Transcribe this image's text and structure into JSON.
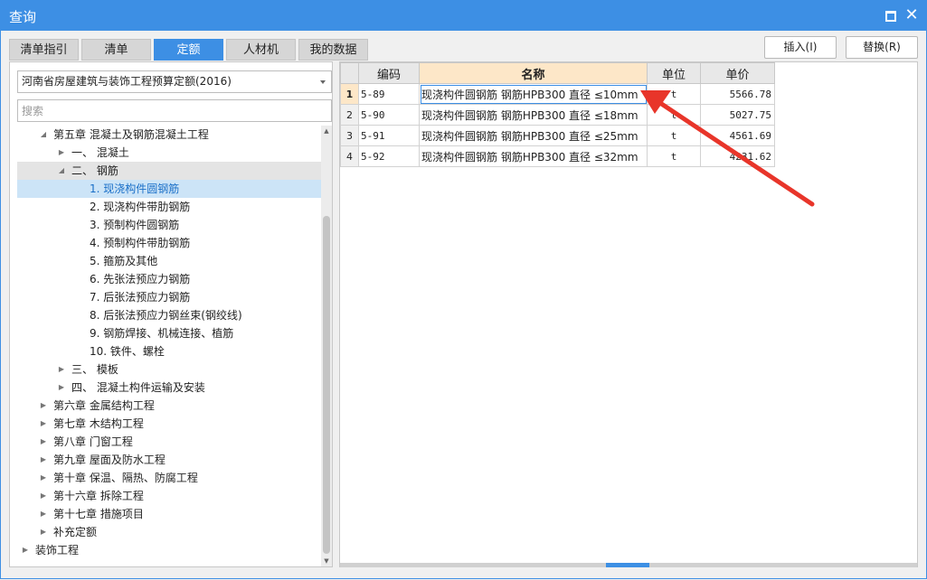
{
  "window": {
    "title": "查询",
    "maximize_icon": "maximize-icon",
    "close_glyph": "✕"
  },
  "tabs": [
    {
      "label": "清单指引",
      "active": false
    },
    {
      "label": "清单",
      "active": false
    },
    {
      "label": "定额",
      "active": true
    },
    {
      "label": "人材机",
      "active": false
    },
    {
      "label": "我的数据",
      "active": false
    }
  ],
  "actions": {
    "insert_label": "插入(I)",
    "replace_label": "替换(R)"
  },
  "left": {
    "quota_library": "河南省房屋建筑与装饰工程预算定额(2016)",
    "search_placeholder": "搜索",
    "search_value": "",
    "tree": [
      {
        "label": "第五章 混凝土及钢筋混凝土工程",
        "level": 1,
        "toggle": "expanded"
      },
      {
        "label": "一、 混凝土",
        "level": 2,
        "toggle": "collapsed"
      },
      {
        "label": "二、 钢筋",
        "level": 2,
        "toggle": "expanded",
        "state": "highlight"
      },
      {
        "label": "1. 现浇构件圆钢筋",
        "level": 3,
        "toggle": "none",
        "state": "selected"
      },
      {
        "label": "2. 现浇构件带肋钢筋",
        "level": 3,
        "toggle": "none"
      },
      {
        "label": "3. 预制构件圆钢筋",
        "level": 3,
        "toggle": "none"
      },
      {
        "label": "4. 预制构件带肋钢筋",
        "level": 3,
        "toggle": "none"
      },
      {
        "label": "5. 箍筋及其他",
        "level": 3,
        "toggle": "none"
      },
      {
        "label": "6. 先张法预应力钢筋",
        "level": 3,
        "toggle": "none"
      },
      {
        "label": "7. 后张法预应力钢筋",
        "level": 3,
        "toggle": "none"
      },
      {
        "label": "8. 后张法预应力钢丝束(钢绞线)",
        "level": 3,
        "toggle": "none"
      },
      {
        "label": "9. 钢筋焊接、机械连接、植筋",
        "level": 3,
        "toggle": "none"
      },
      {
        "label": "10. 铁件、螺栓",
        "level": 3,
        "toggle": "none"
      },
      {
        "label": "三、 模板",
        "level": 2,
        "toggle": "collapsed"
      },
      {
        "label": "四、 混凝土构件运输及安装",
        "level": 2,
        "toggle": "collapsed"
      },
      {
        "label": "第六章 金属结构工程",
        "level": 1,
        "toggle": "collapsed"
      },
      {
        "label": "第七章 木结构工程",
        "level": 1,
        "toggle": "collapsed"
      },
      {
        "label": "第八章 门窗工程",
        "level": 1,
        "toggle": "collapsed"
      },
      {
        "label": "第九章 屋面及防水工程",
        "level": 1,
        "toggle": "collapsed"
      },
      {
        "label": "第十章 保温、隔热、防腐工程",
        "level": 1,
        "toggle": "collapsed"
      },
      {
        "label": "第十六章 拆除工程",
        "level": 1,
        "toggle": "collapsed"
      },
      {
        "label": "第十七章 措施项目",
        "level": 1,
        "toggle": "collapsed"
      },
      {
        "label": "补充定额",
        "level": 1,
        "toggle": "collapsed"
      },
      {
        "label": "装饰工程",
        "level": 0,
        "toggle": "collapsed"
      }
    ]
  },
  "grid": {
    "columns": [
      "编码",
      "名称",
      "单位",
      "单价"
    ],
    "rows": [
      {
        "no": "1",
        "code": "5-89",
        "name": "现浇构件圆钢筋 钢筋HPB300 直径 ≤10mm",
        "unit": "t",
        "price": "5566.78",
        "selected": true
      },
      {
        "no": "2",
        "code": "5-90",
        "name": "现浇构件圆钢筋 钢筋HPB300 直径 ≤18mm",
        "unit": "t",
        "price": "5027.75",
        "selected": false
      },
      {
        "no": "3",
        "code": "5-91",
        "name": "现浇构件圆钢筋 钢筋HPB300 直径 ≤25mm",
        "unit": "t",
        "price": "4561.69",
        "selected": false
      },
      {
        "no": "4",
        "code": "5-92",
        "name": "现浇构件圆钢筋 钢筋HPB300 直径 ≤32mm",
        "unit": "t",
        "price": "4231.62",
        "selected": false
      }
    ]
  },
  "colors": {
    "accent": "#3d8fe4",
    "selected_row": "#fde7c8",
    "tree_selected": "#cce4f7",
    "annotation_arrow": "#e8352a"
  }
}
